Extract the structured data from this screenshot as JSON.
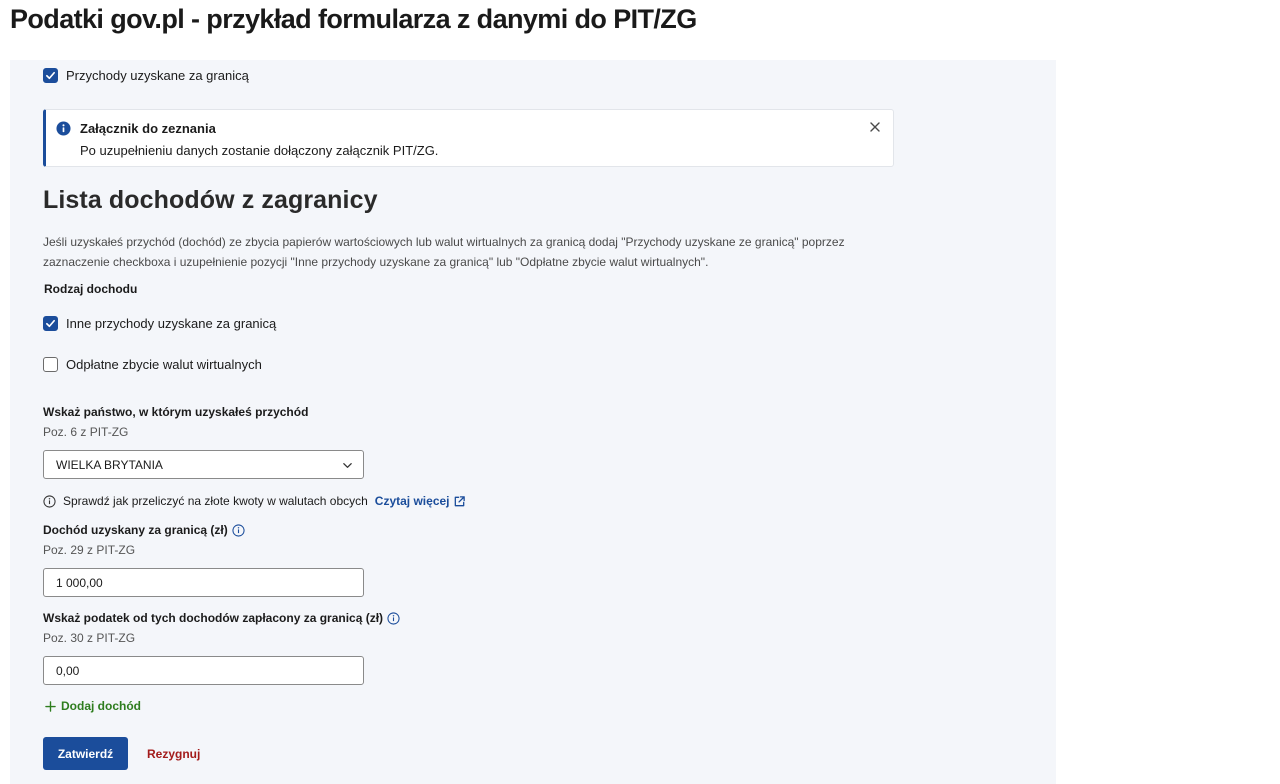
{
  "page": {
    "heading": "Podatki gov.pl - przykład formularza z danymi do PIT/ZG"
  },
  "form": {
    "top_checkbox": {
      "label": "Przychody uzyskane za granicą",
      "checked": true
    },
    "alert": {
      "title": "Załącznik do zeznania",
      "text": "Po uzupełnieniu danych zostanie dołączony załącznik PIT/ZG."
    },
    "section": {
      "title": "Lista dochodów z zagranicy",
      "description": "Jeśli uzyskałeś przychód (dochód) ze zbycia papierów wartościowych lub walut wirtualnych za granicą dodaj \"Przychody uzyskane ze granicą\" poprzez zaznaczenie checkboxa i uzupełnienie pozycji \"Inne przychody uzyskane za granicą\" lub \"Odpłatne zbycie walut wirtualnych\"."
    },
    "income_type": {
      "label": "Rodzaj dochodu",
      "options": [
        {
          "label": "Inne przychody uzyskane za granicą",
          "checked": true
        },
        {
          "label": "Odpłatne zbycie walut wirtualnych",
          "checked": false
        }
      ]
    },
    "country": {
      "label": "Wskaż państwo, w którym uzyskałeś przychód",
      "hint": "Poz. 6 z PIT-ZG",
      "selected": "WIELKA BRYTANIA"
    },
    "help": {
      "text": "Sprawdź jak przeliczyć na złote kwoty w walutach obcych",
      "link": "Czytaj więcej"
    },
    "income": {
      "label": "Dochód uzyskany za granicą (zł)",
      "hint": "Poz. 29 z PIT-ZG",
      "value": "1 000,00"
    },
    "tax": {
      "label": "Wskaż podatek od tych dochodów zapłacony za granicą (zł)",
      "hint": "Poz. 30 z PIT-ZG",
      "value": "0,00"
    },
    "add_income": "Dodaj dochód",
    "buttons": {
      "submit": "Zatwierdź",
      "cancel": "Rezygnuj"
    }
  },
  "colors": {
    "primary": "#1b4d9b",
    "add": "#2e7d1e",
    "cancel": "#a31b1b",
    "panel": "#f4f6fa"
  },
  "icons": [
    "check-icon",
    "info-icon",
    "close-icon",
    "chevron-down-icon",
    "external-link-icon",
    "plus-icon"
  ]
}
